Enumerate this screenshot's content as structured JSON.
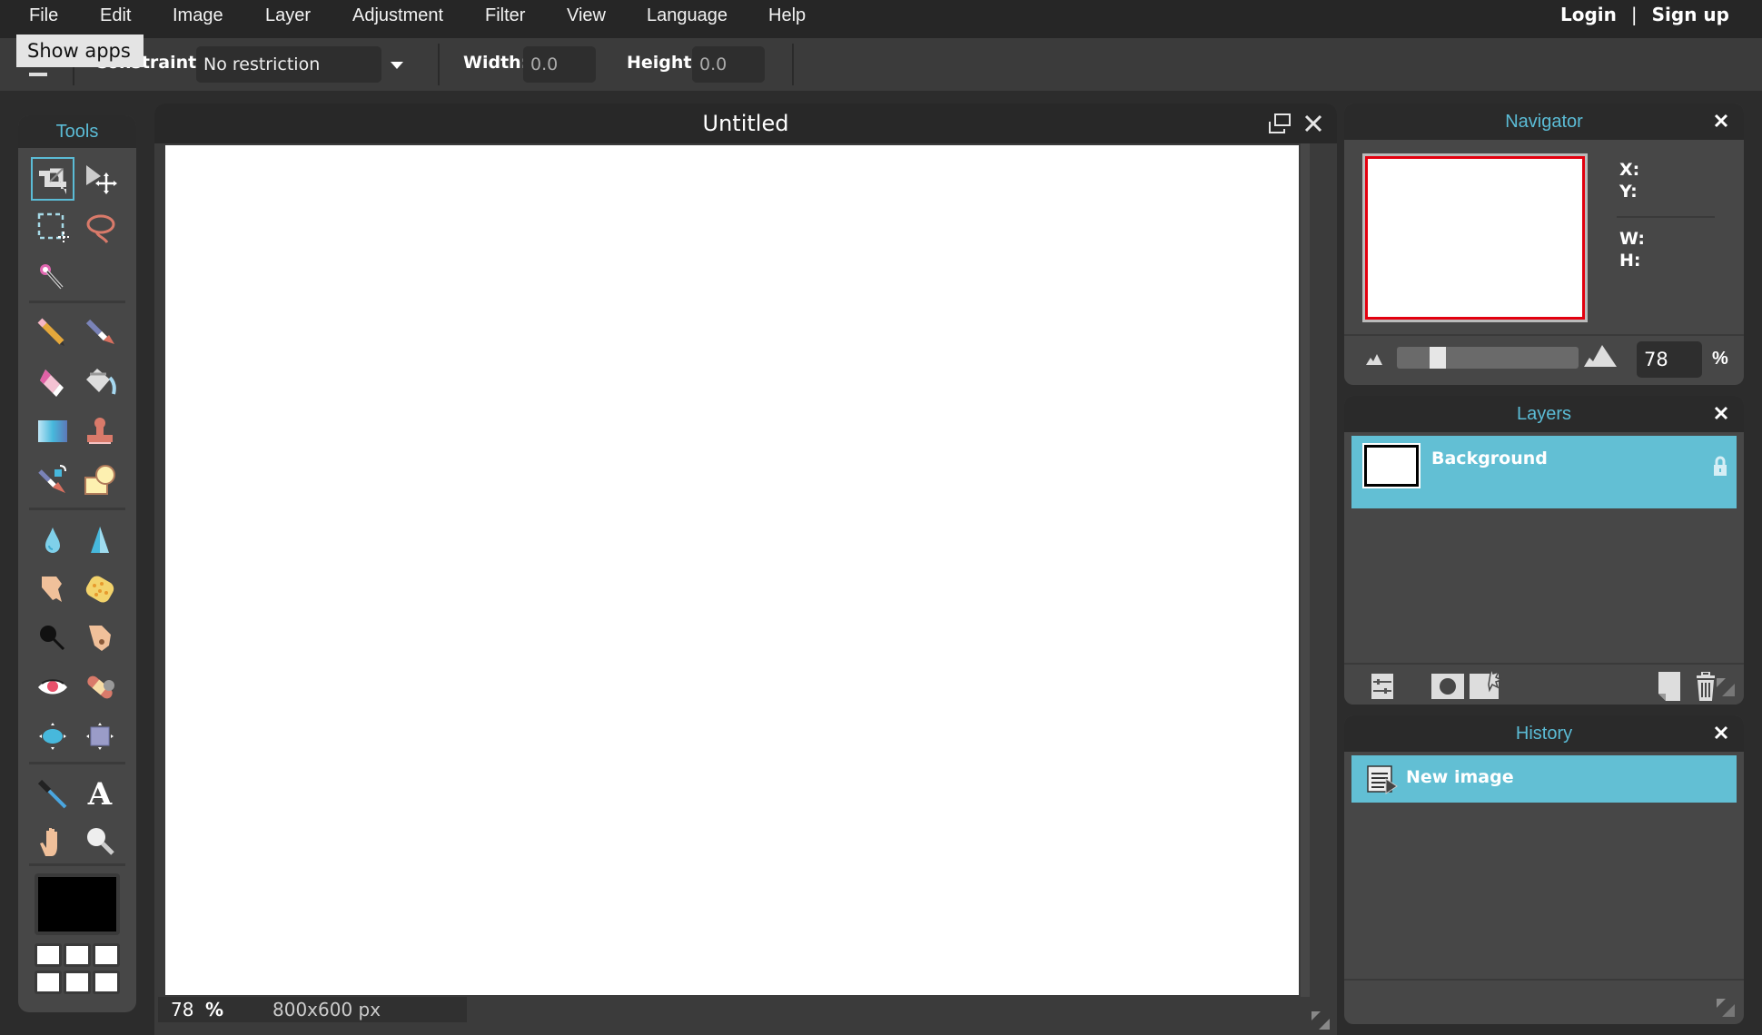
{
  "menu": {
    "items": [
      "File",
      "Edit",
      "Image",
      "Layer",
      "Adjustment",
      "Filter",
      "View",
      "Language",
      "Help"
    ],
    "login": "Login",
    "separator": "|",
    "signup": "Sign up"
  },
  "tooltip": "Show apps",
  "toolbar": {
    "constraint_label": "Constraint:",
    "constraint_value": "No restriction",
    "width_label": "Width:",
    "width_value": "0.0",
    "height_label": "Height:",
    "height_value": "0.0"
  },
  "tools": {
    "title": "Tools",
    "items": [
      {
        "name": "crop",
        "icon": "crop-icon",
        "active": true
      },
      {
        "name": "move",
        "icon": "move-icon"
      },
      {
        "name": "marquee",
        "icon": "marquee-select-icon"
      },
      {
        "name": "lasso",
        "icon": "lasso-icon"
      },
      {
        "name": "magic-wand",
        "icon": "magic-wand-icon"
      },
      {
        "name": "pencil",
        "icon": "pencil-icon"
      },
      {
        "name": "brush",
        "icon": "brush-icon"
      },
      {
        "name": "eraser",
        "icon": "eraser-icon"
      },
      {
        "name": "paint-bucket",
        "icon": "paint-bucket-icon"
      },
      {
        "name": "gradient",
        "icon": "gradient-icon"
      },
      {
        "name": "clone-stamp",
        "icon": "clone-stamp-icon"
      },
      {
        "name": "color-replace",
        "icon": "color-replace-icon"
      },
      {
        "name": "shape",
        "icon": "shape-icon"
      },
      {
        "name": "blur",
        "icon": "blur-drop-icon"
      },
      {
        "name": "sharpen",
        "icon": "sharpen-cone-icon"
      },
      {
        "name": "smudge",
        "icon": "smudge-finger-icon"
      },
      {
        "name": "sponge",
        "icon": "sponge-icon"
      },
      {
        "name": "burn",
        "icon": "burn-icon"
      },
      {
        "name": "dodge",
        "icon": "dodge-icon"
      },
      {
        "name": "red-eye",
        "icon": "red-eye-icon"
      },
      {
        "name": "spot-heal",
        "icon": "bandage-icon"
      },
      {
        "name": "bloat",
        "icon": "bloat-icon"
      },
      {
        "name": "pinch",
        "icon": "pinch-icon"
      },
      {
        "name": "color-picker",
        "icon": "eyedropper-icon"
      },
      {
        "name": "type",
        "icon": "type-icon",
        "glyph": "A"
      },
      {
        "name": "hand",
        "icon": "hand-icon"
      },
      {
        "name": "zoom",
        "icon": "zoom-icon"
      }
    ],
    "foreground_color": "#000000",
    "swatches": [
      "#ffffff",
      "#ffffff",
      "#ffffff",
      "#ffffff",
      "#ffffff",
      "#ffffff"
    ]
  },
  "document": {
    "title": "Untitled",
    "zoom": "78",
    "zoom_unit": "%",
    "size": "800x600 px"
  },
  "navigator": {
    "title": "Navigator",
    "x_label": "X:",
    "y_label": "Y:",
    "w_label": "W:",
    "h_label": "H:",
    "zoom_value": "78",
    "zoom_unit": "%",
    "zoom_slider_fraction": 0.2
  },
  "layers": {
    "title": "Layers",
    "items": [
      {
        "name": "Background",
        "locked": true,
        "selected": true
      }
    ]
  },
  "history": {
    "title": "History",
    "items": [
      {
        "name": "New image",
        "selected": true
      }
    ]
  },
  "colors": {
    "accent": "#5bbcd6",
    "selection": "#62bfd4",
    "nav_frame": "#e3000f"
  }
}
